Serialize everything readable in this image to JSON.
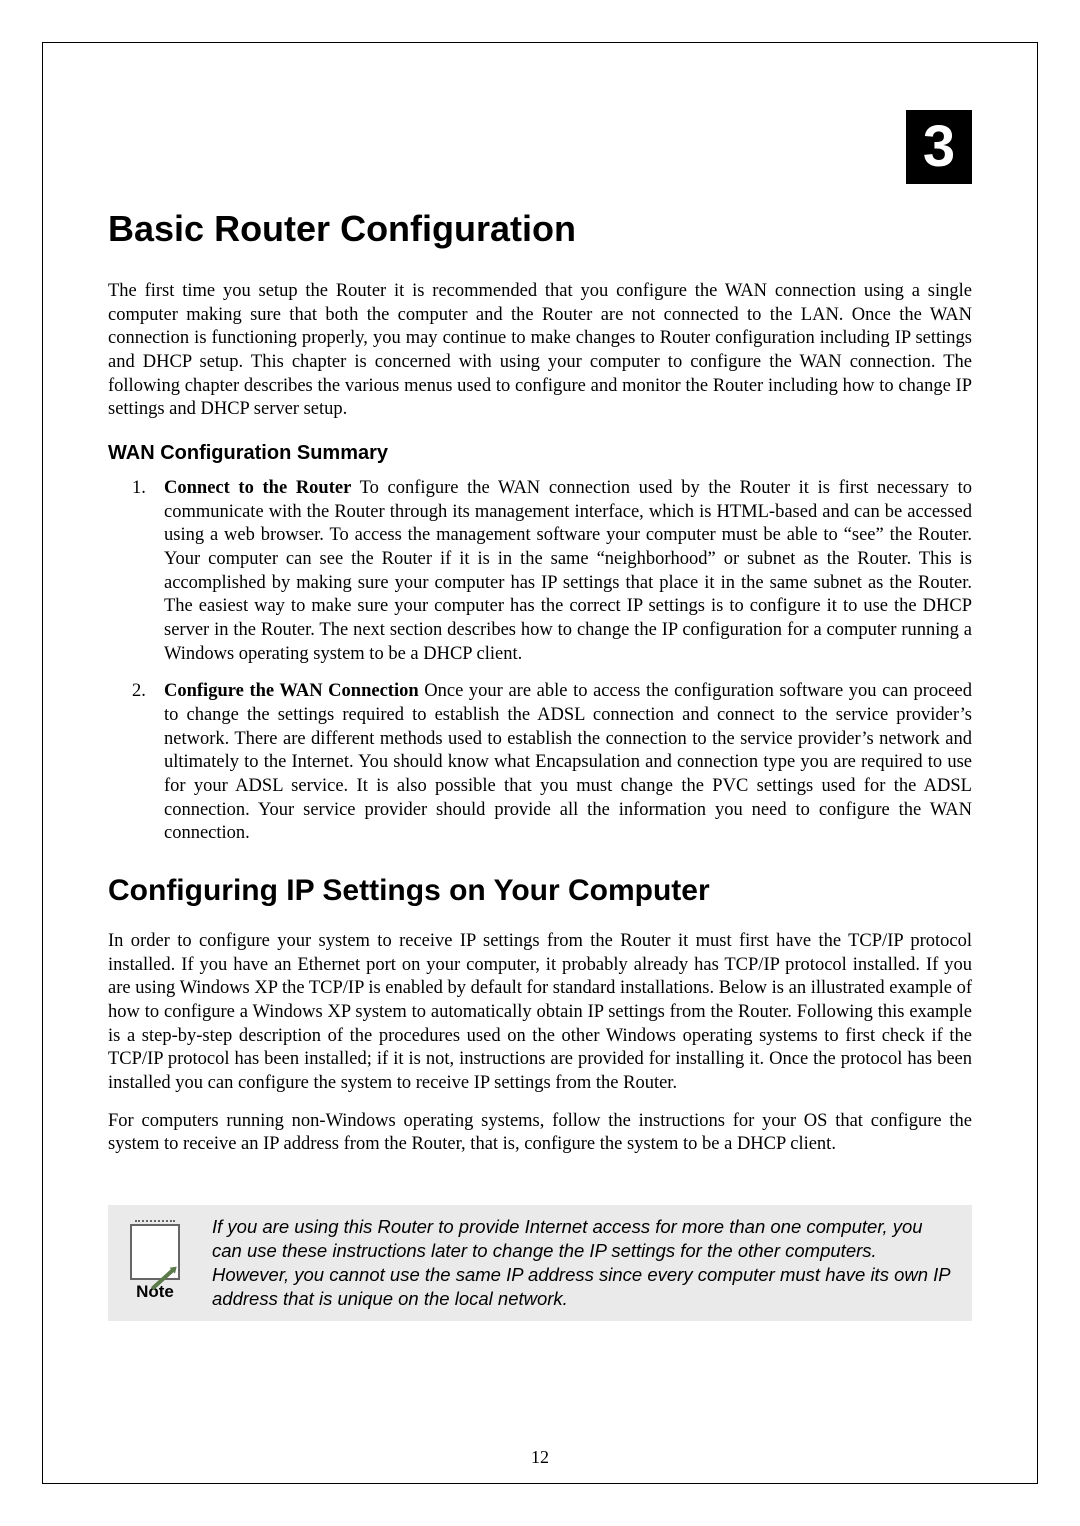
{
  "chapter": {
    "number": "3",
    "title": "Basic Router Configuration",
    "intro": "The first time you setup the Router it is recommended that you configure the WAN connection using a single computer making sure that both the computer and the Router are not connected to the LAN. Once the WAN connection is functioning properly, you may continue to make changes to Router configuration including IP settings and DHCP setup. This chapter is concerned with using your computer to configure the WAN connection. The following chapter describes the various menus used to configure and monitor the Router including how to change IP settings and DHCP server setup."
  },
  "wan_summary": {
    "heading": "WAN Configuration Summary",
    "items": [
      {
        "num": "1.",
        "lead": "Connect to the Router",
        "text": " To configure the WAN connection used by the Router it is first necessary to communicate with the Router through its management interface, which is HTML-based and can be accessed using a web browser. To access the management software your computer must be able to “see” the Router. Your computer can see the Router if it is in the same “neighborhood” or subnet as the Router. This is accomplished by making sure your computer has IP settings that place it in the same subnet as the Router. The easiest way to make sure your computer has the correct IP settings is to configure it to use the DHCP server in the Router. The next section describes how to change the IP configuration for a computer running a Windows operating system to be a DHCP client."
      },
      {
        "num": "2.",
        "lead": "Configure the WAN Connection",
        "text": " Once your are able to access the configuration software you can proceed to change the settings required to establish the ADSL connection and connect to the service provider’s network. There are different methods used to establish the connection to the service provider’s network and ultimately to the Internet. You should know what Encapsulation and connection type you are required to use for your ADSL service. It is also possible that you must change the PVC settings used for the ADSL connection. Your service provider should provide all the information you need to configure the WAN connection."
      }
    ]
  },
  "ip_config": {
    "heading": "Configuring IP Settings on Your Computer",
    "para1": "In order to configure your system to receive IP settings from the Router it must first have the TCP/IP protocol installed. If you have an Ethernet port on your computer, it probably already has TCP/IP protocol installed. If you are using Windows XP the TCP/IP is enabled by default for standard installations. Below is an illustrated example of how to configure a Windows XP system to automatically obtain IP settings from the Router. Following this example is a step-by-step description of the procedures used on the other Windows operating systems to first check if the TCP/IP protocol has been installed; if it is not, instructions are provided for installing it. Once the protocol has been installed you can configure the system to receive IP settings from the Router.",
    "para2": "For computers running non-Windows operating systems, follow the instructions for your OS that configure the system to receive an IP address from the Router, that is, configure the system to be a DHCP client."
  },
  "note": {
    "label": "Note",
    "text": "If you are using this Router to provide Internet access for more than one computer, you can use these instructions later to change the IP settings for the other computers. However, you cannot use the same IP address since every computer must have its own IP address that is unique on the local network."
  },
  "page_number": "12"
}
